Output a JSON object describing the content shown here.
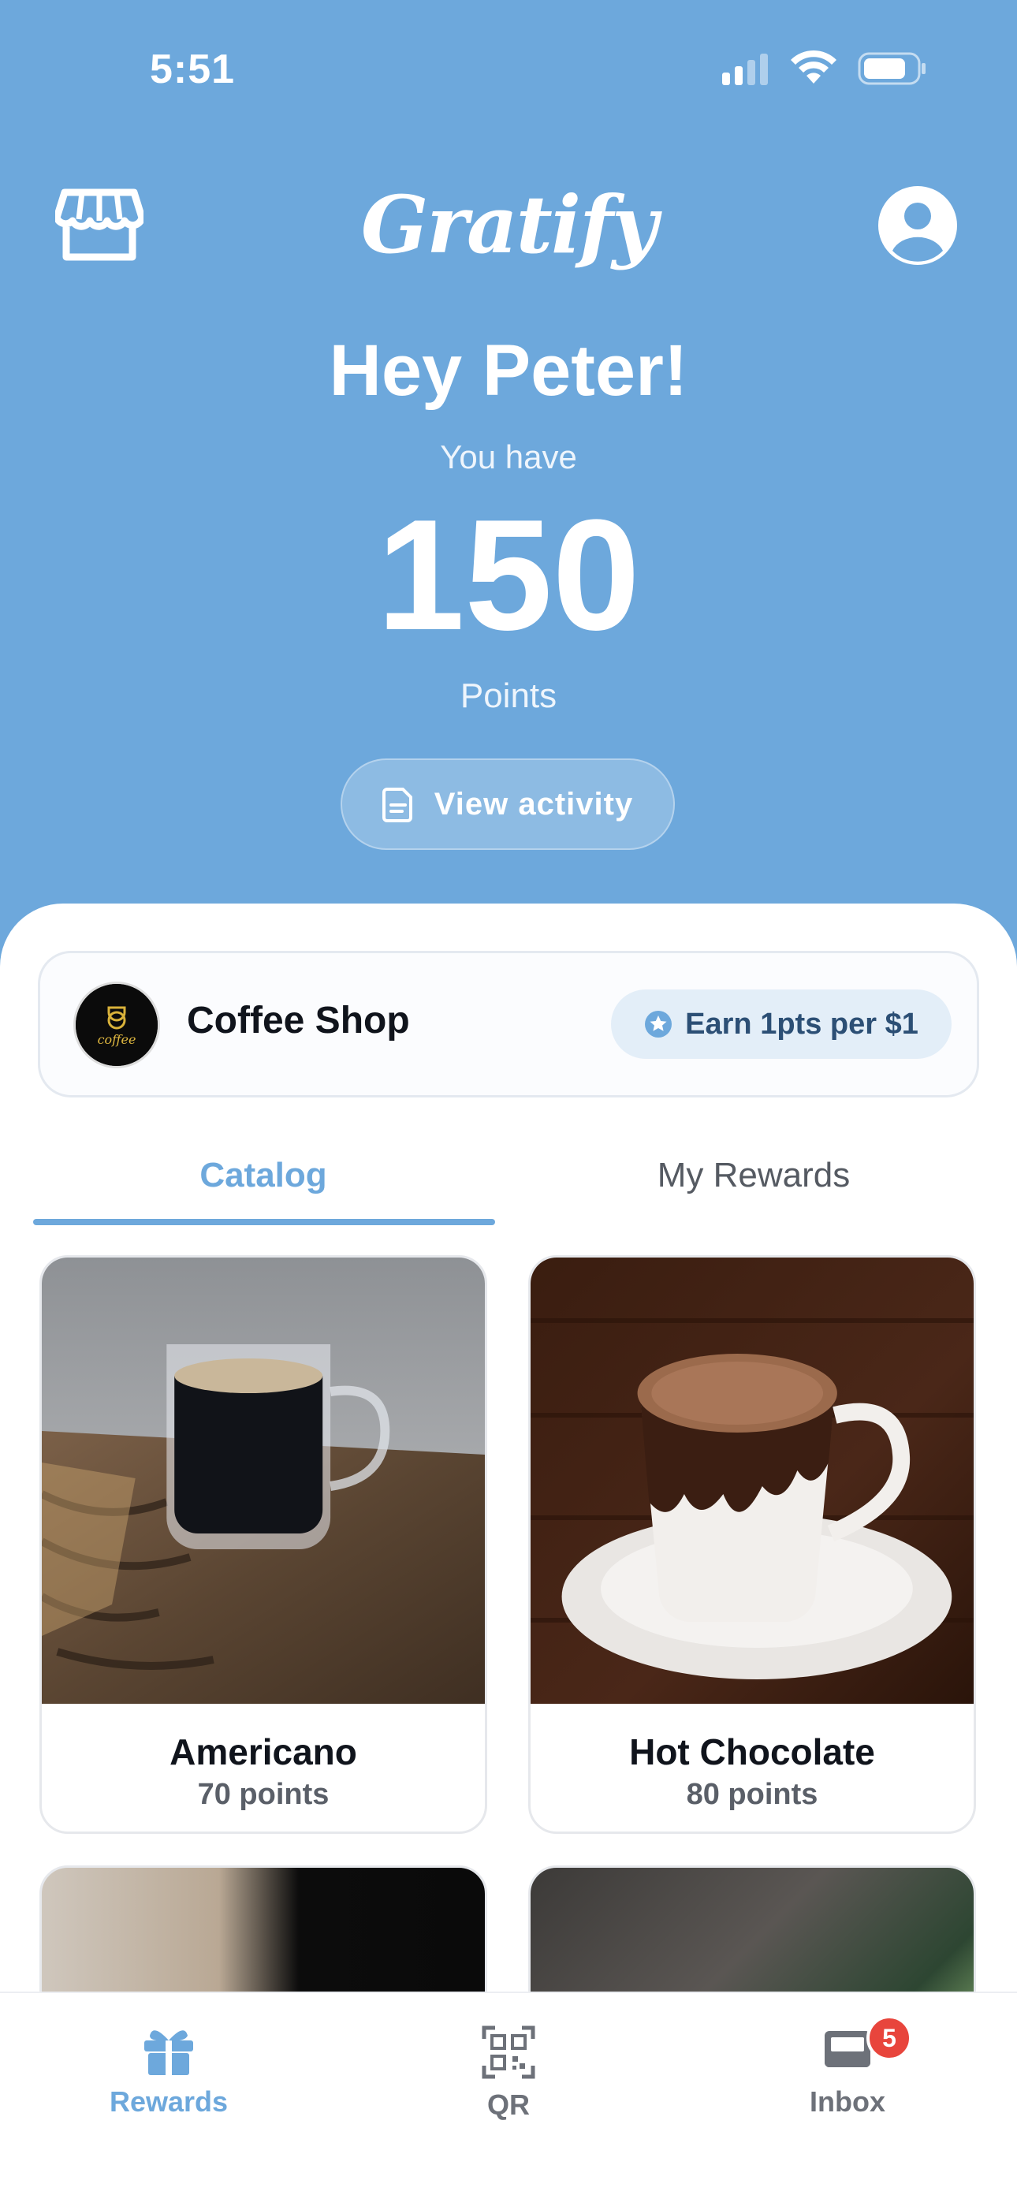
{
  "status_bar": {
    "time": "5:51"
  },
  "header": {
    "logo": "Gratify",
    "greeting": "Hey Peter!",
    "you_have": "You have",
    "points_value": "150",
    "points_label": "Points",
    "view_activity_label": "View activity"
  },
  "shop": {
    "name": "Coffee Shop",
    "earn_label": "Earn 1pts per $1",
    "avatar_text": "coffee"
  },
  "tabs": [
    {
      "label": "Catalog",
      "active": true
    },
    {
      "label": "My Rewards",
      "active": false
    }
  ],
  "catalog": [
    {
      "title": "Americano",
      "points": "70 points"
    },
    {
      "title": "Hot Chocolate",
      "points": "80 points"
    }
  ],
  "bottom_nav": [
    {
      "label": "Rewards",
      "icon": "gift-icon",
      "active": true
    },
    {
      "label": "QR",
      "icon": "qr-code-icon",
      "active": false
    },
    {
      "label": "Inbox",
      "icon": "inbox-icon",
      "active": false,
      "badge": "5"
    }
  ],
  "colors": {
    "primary": "#6da8dc",
    "badge": "#e8453c",
    "text_dark": "#10141c"
  }
}
